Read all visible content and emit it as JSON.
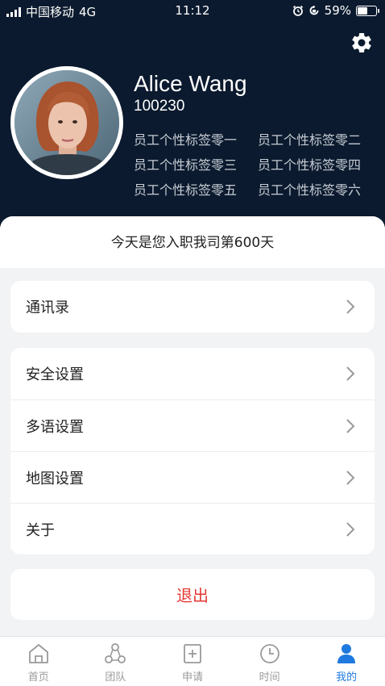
{
  "status_bar": {
    "carrier": "中国移动",
    "network": "4G",
    "time": "11:12",
    "battery": "59%",
    "battery_level": 0.59
  },
  "profile": {
    "name": "Alice Wang",
    "employee_id": "100230",
    "tags": [
      "员工个性标签零一",
      "员工个性标签零二",
      "员工个性标签零三",
      "员工个性标签零四",
      "员工个性标签零五",
      "员工个性标签零六"
    ]
  },
  "tenure_text": "今天是您入职我司第600天",
  "menu_group_1": [
    {
      "label": "通讯录"
    }
  ],
  "menu_group_2": [
    {
      "label": "安全设置"
    },
    {
      "label": "多语设置"
    },
    {
      "label": "地图设置"
    },
    {
      "label": "关于"
    }
  ],
  "logout_label": "退出",
  "tabs": [
    {
      "label": "首页",
      "icon": "home-icon"
    },
    {
      "label": "团队",
      "icon": "team-icon"
    },
    {
      "label": "申请",
      "icon": "apply-icon"
    },
    {
      "label": "时间",
      "icon": "clock-icon"
    },
    {
      "label": "我的",
      "icon": "profile-icon"
    }
  ],
  "active_tab": 4,
  "colors": {
    "header_bg": "#0b1a2e",
    "accent": "#1f7ae0",
    "logout": "#e53935",
    "tab_inactive": "#9a9a9a"
  }
}
